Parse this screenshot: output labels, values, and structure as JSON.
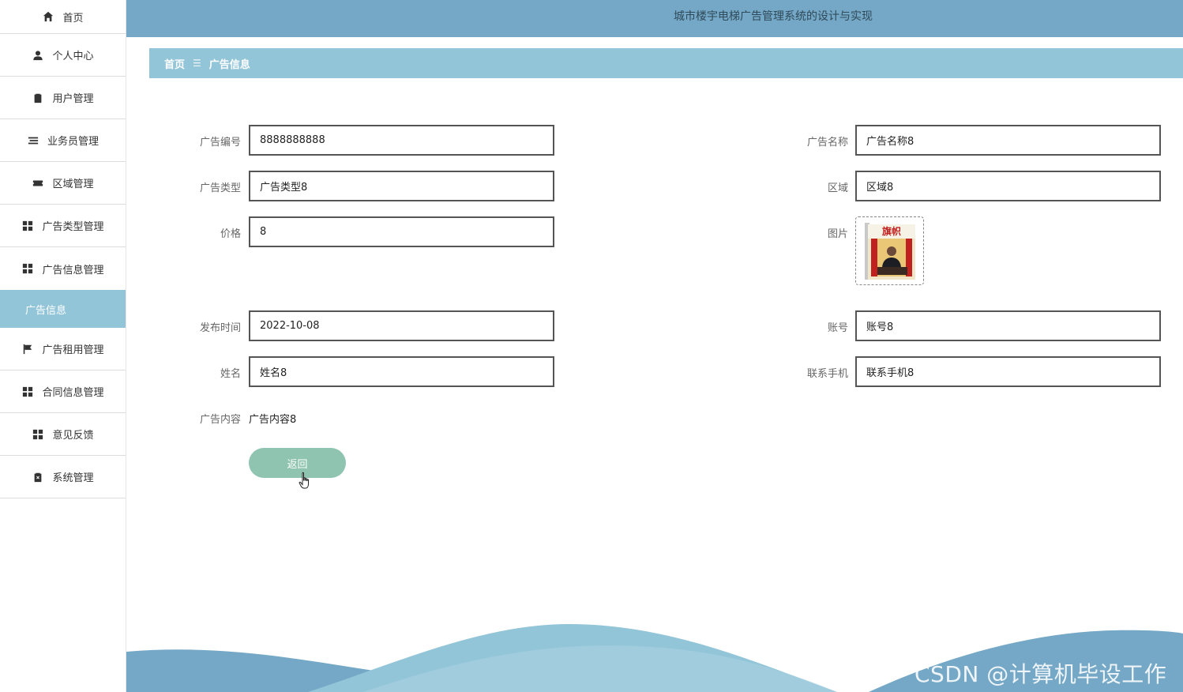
{
  "app": {
    "title": "城市楼宇电梯广告管理系统的设计与实现"
  },
  "sidebar": {
    "items": [
      {
        "label": "首页",
        "icon": "home-icon"
      },
      {
        "label": "个人中心",
        "icon": "user-icon"
      },
      {
        "label": "用户管理",
        "icon": "clipboard-icon"
      },
      {
        "label": "业务员管理",
        "icon": "list-icon"
      },
      {
        "label": "区域管理",
        "icon": "ticket-icon"
      },
      {
        "label": "广告类型管理",
        "icon": "grid-icon"
      },
      {
        "label": "广告信息管理",
        "icon": "grid-icon"
      },
      {
        "label": "广告信息",
        "icon": "",
        "active": true
      },
      {
        "label": "广告租用管理",
        "icon": "flag-icon"
      },
      {
        "label": "合同信息管理",
        "icon": "grid-icon"
      },
      {
        "label": "意见反馈",
        "icon": "grid-icon"
      },
      {
        "label": "系统管理",
        "icon": "clipboard-x-icon"
      }
    ]
  },
  "breadcrumb": {
    "home": "首页",
    "separator": "☰",
    "current": "广告信息"
  },
  "form": {
    "ad_no": {
      "label": "广告编号",
      "value": "8888888888"
    },
    "ad_type": {
      "label": "广告类型",
      "value": "广告类型8"
    },
    "price": {
      "label": "价格",
      "value": "8"
    },
    "publish_time": {
      "label": "发布时间",
      "value": "2022-10-08"
    },
    "name": {
      "label": "姓名",
      "value": "姓名8"
    },
    "content": {
      "label": "广告内容",
      "value": "广告内容8"
    },
    "ad_name": {
      "label": "广告名称",
      "value": "广告名称8"
    },
    "region": {
      "label": "区域",
      "value": "区域8"
    },
    "image": {
      "label": "图片"
    },
    "account": {
      "label": "账号",
      "value": "账号8"
    },
    "phone": {
      "label": "联系手机",
      "value": "联系手机8"
    }
  },
  "actions": {
    "back_label": "返回"
  },
  "watermark": "CSDN @计算机毕设工作室",
  "colors": {
    "topbar": "#74a8c6",
    "accent": "#93c5d9",
    "button": "#8fc4b1"
  }
}
